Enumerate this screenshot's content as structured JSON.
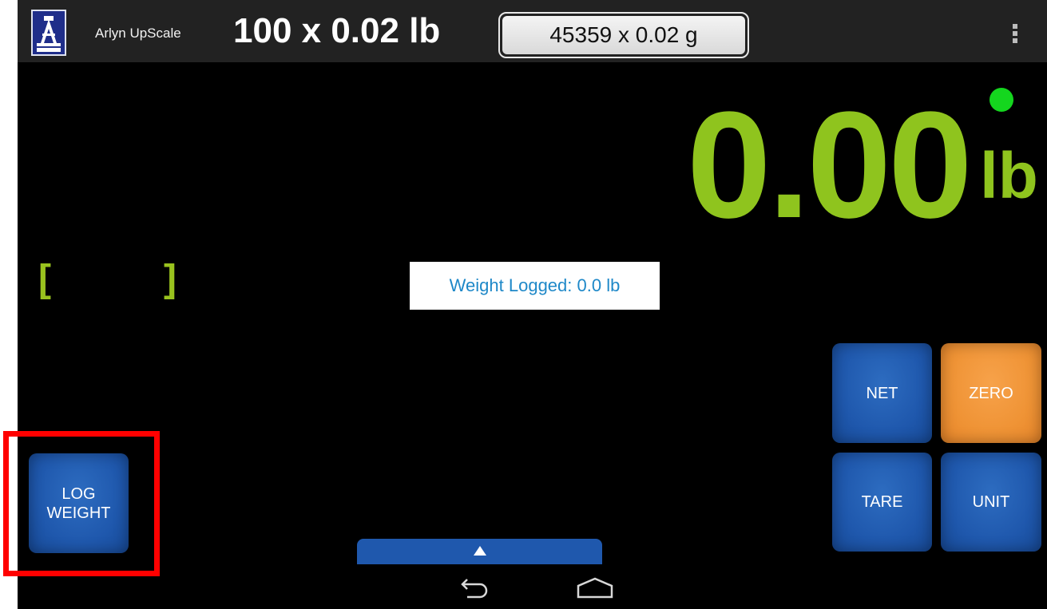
{
  "app": {
    "title": "Arlyn UpScale",
    "logo_icon": "arlyn-logo-icon"
  },
  "header": {
    "capacity_lb": "100 x 0.02 lb",
    "capacity_g": "45359 x 0.02 g",
    "menu_icon": "overflow-menu-icon"
  },
  "readout": {
    "value": "0.00",
    "unit": "lb",
    "stable_indicator_color": "#14d61e",
    "display_color": "#8fc41e",
    "bracket_left": "[",
    "bracket_right": "]"
  },
  "toast": {
    "message": "Weight Logged: 0.0 lb"
  },
  "buttons": {
    "log_weight": "LOG\nWEIGHT",
    "net": "NET",
    "zero": "ZERO",
    "tare": "TARE",
    "unit": "UNIT"
  },
  "colors": {
    "button_blue": "#1f58ad",
    "button_orange": "#ef9335",
    "highlight": "#ff0000"
  },
  "nav": {
    "back_icon": "back-icon",
    "home_icon": "home-icon",
    "drawer_icon": "drawer-up-arrow-icon"
  }
}
